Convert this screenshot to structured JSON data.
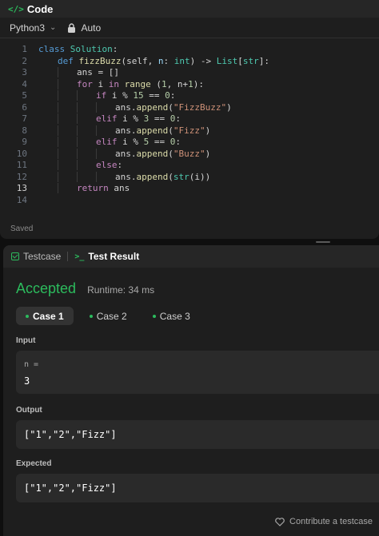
{
  "code_panel": {
    "icon": "code-icon",
    "title": "Code",
    "language": "Python3",
    "mode": "Auto",
    "lines": [
      {
        "n": "1"
      },
      {
        "n": "2"
      },
      {
        "n": "3"
      },
      {
        "n": "4"
      },
      {
        "n": "5"
      },
      {
        "n": "6"
      },
      {
        "n": "7"
      },
      {
        "n": "8"
      },
      {
        "n": "9"
      },
      {
        "n": "10"
      },
      {
        "n": "11"
      },
      {
        "n": "12"
      },
      {
        "n": "13"
      },
      {
        "n": "14"
      }
    ],
    "code": {
      "l1": [
        "class",
        "Solution",
        ":"
      ],
      "l2": [
        "def",
        "fizzBuzz",
        "(self, ",
        "n",
        ": ",
        "int",
        ") -> ",
        "List",
        "[",
        "str",
        "]:"
      ],
      "l3": [
        "ans = []"
      ],
      "l4": [
        "for",
        " i ",
        "in",
        " ",
        "range",
        " (",
        "1",
        ", n+",
        "1",
        "):"
      ],
      "l5": [
        "if",
        " i % ",
        "15",
        " == ",
        "0",
        ":"
      ],
      "l6": [
        "ans.",
        "append",
        "(",
        "\"FizzBuzz\"",
        ")"
      ],
      "l7": [
        "elif",
        " i % ",
        "3",
        " == ",
        "0",
        ":"
      ],
      "l8": [
        "ans.",
        "append",
        "(",
        "\"Fizz\"",
        ")"
      ],
      "l9": [
        "elif",
        " i % ",
        "5",
        " == ",
        "0",
        ":"
      ],
      "l10": [
        "ans.",
        "append",
        "(",
        "\"Buzz\"",
        ")"
      ],
      "l11": [
        "else",
        ":"
      ],
      "l12": [
        "ans.",
        "append",
        "(",
        "str",
        "(i))"
      ],
      "l13": [
        "return",
        " ans"
      ]
    },
    "status": "Saved"
  },
  "result_panel": {
    "tabs": [
      {
        "label": "Testcase",
        "icon": "checkbox-icon"
      },
      {
        "label": "Test Result",
        "icon": "terminal-icon"
      }
    ],
    "verdict": "Accepted",
    "runtime": "Runtime: 34 ms",
    "cases": [
      "Case 1",
      "Case 2",
      "Case 3"
    ],
    "input_label": "Input",
    "input_var": "n =",
    "input_value": "3",
    "output_label": "Output",
    "output_value": "[\"1\",\"2\",\"Fizz\"]",
    "expected_label": "Expected",
    "expected_value": "[\"1\",\"2\",\"Fizz\"]",
    "contribute": "Contribute a testcase"
  },
  "colors": {
    "accent_green": "#2cbb5d",
    "panel_bg": "#1e1e1e",
    "page_bg": "#0f0f0f"
  }
}
